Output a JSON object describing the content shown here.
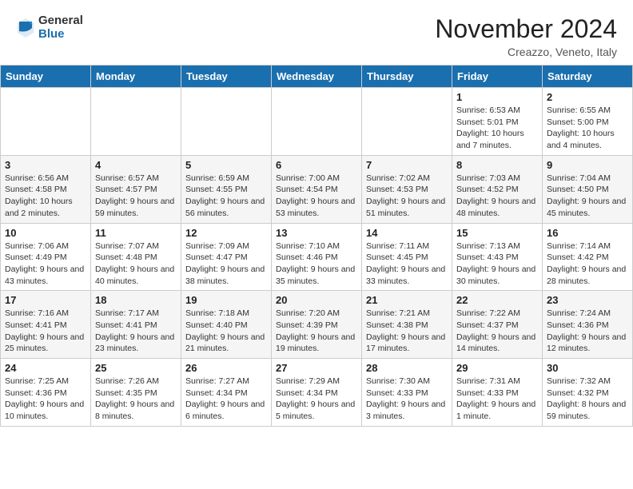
{
  "header": {
    "logo_general": "General",
    "logo_blue": "Blue",
    "month": "November 2024",
    "location": "Creazzo, Veneto, Italy"
  },
  "days_of_week": [
    "Sunday",
    "Monday",
    "Tuesday",
    "Wednesday",
    "Thursday",
    "Friday",
    "Saturday"
  ],
  "weeks": [
    [
      {
        "day": "",
        "info": ""
      },
      {
        "day": "",
        "info": ""
      },
      {
        "day": "",
        "info": ""
      },
      {
        "day": "",
        "info": ""
      },
      {
        "day": "",
        "info": ""
      },
      {
        "day": "1",
        "info": "Sunrise: 6:53 AM\nSunset: 5:01 PM\nDaylight: 10 hours and 7 minutes."
      },
      {
        "day": "2",
        "info": "Sunrise: 6:55 AM\nSunset: 5:00 PM\nDaylight: 10 hours and 4 minutes."
      }
    ],
    [
      {
        "day": "3",
        "info": "Sunrise: 6:56 AM\nSunset: 4:58 PM\nDaylight: 10 hours and 2 minutes."
      },
      {
        "day": "4",
        "info": "Sunrise: 6:57 AM\nSunset: 4:57 PM\nDaylight: 9 hours and 59 minutes."
      },
      {
        "day": "5",
        "info": "Sunrise: 6:59 AM\nSunset: 4:55 PM\nDaylight: 9 hours and 56 minutes."
      },
      {
        "day": "6",
        "info": "Sunrise: 7:00 AM\nSunset: 4:54 PM\nDaylight: 9 hours and 53 minutes."
      },
      {
        "day": "7",
        "info": "Sunrise: 7:02 AM\nSunset: 4:53 PM\nDaylight: 9 hours and 51 minutes."
      },
      {
        "day": "8",
        "info": "Sunrise: 7:03 AM\nSunset: 4:52 PM\nDaylight: 9 hours and 48 minutes."
      },
      {
        "day": "9",
        "info": "Sunrise: 7:04 AM\nSunset: 4:50 PM\nDaylight: 9 hours and 45 minutes."
      }
    ],
    [
      {
        "day": "10",
        "info": "Sunrise: 7:06 AM\nSunset: 4:49 PM\nDaylight: 9 hours and 43 minutes."
      },
      {
        "day": "11",
        "info": "Sunrise: 7:07 AM\nSunset: 4:48 PM\nDaylight: 9 hours and 40 minutes."
      },
      {
        "day": "12",
        "info": "Sunrise: 7:09 AM\nSunset: 4:47 PM\nDaylight: 9 hours and 38 minutes."
      },
      {
        "day": "13",
        "info": "Sunrise: 7:10 AM\nSunset: 4:46 PM\nDaylight: 9 hours and 35 minutes."
      },
      {
        "day": "14",
        "info": "Sunrise: 7:11 AM\nSunset: 4:45 PM\nDaylight: 9 hours and 33 minutes."
      },
      {
        "day": "15",
        "info": "Sunrise: 7:13 AM\nSunset: 4:43 PM\nDaylight: 9 hours and 30 minutes."
      },
      {
        "day": "16",
        "info": "Sunrise: 7:14 AM\nSunset: 4:42 PM\nDaylight: 9 hours and 28 minutes."
      }
    ],
    [
      {
        "day": "17",
        "info": "Sunrise: 7:16 AM\nSunset: 4:41 PM\nDaylight: 9 hours and 25 minutes."
      },
      {
        "day": "18",
        "info": "Sunrise: 7:17 AM\nSunset: 4:41 PM\nDaylight: 9 hours and 23 minutes."
      },
      {
        "day": "19",
        "info": "Sunrise: 7:18 AM\nSunset: 4:40 PM\nDaylight: 9 hours and 21 minutes."
      },
      {
        "day": "20",
        "info": "Sunrise: 7:20 AM\nSunset: 4:39 PM\nDaylight: 9 hours and 19 minutes."
      },
      {
        "day": "21",
        "info": "Sunrise: 7:21 AM\nSunset: 4:38 PM\nDaylight: 9 hours and 17 minutes."
      },
      {
        "day": "22",
        "info": "Sunrise: 7:22 AM\nSunset: 4:37 PM\nDaylight: 9 hours and 14 minutes."
      },
      {
        "day": "23",
        "info": "Sunrise: 7:24 AM\nSunset: 4:36 PM\nDaylight: 9 hours and 12 minutes."
      }
    ],
    [
      {
        "day": "24",
        "info": "Sunrise: 7:25 AM\nSunset: 4:36 PM\nDaylight: 9 hours and 10 minutes."
      },
      {
        "day": "25",
        "info": "Sunrise: 7:26 AM\nSunset: 4:35 PM\nDaylight: 9 hours and 8 minutes."
      },
      {
        "day": "26",
        "info": "Sunrise: 7:27 AM\nSunset: 4:34 PM\nDaylight: 9 hours and 6 minutes."
      },
      {
        "day": "27",
        "info": "Sunrise: 7:29 AM\nSunset: 4:34 PM\nDaylight: 9 hours and 5 minutes."
      },
      {
        "day": "28",
        "info": "Sunrise: 7:30 AM\nSunset: 4:33 PM\nDaylight: 9 hours and 3 minutes."
      },
      {
        "day": "29",
        "info": "Sunrise: 7:31 AM\nSunset: 4:33 PM\nDaylight: 9 hours and 1 minute."
      },
      {
        "day": "30",
        "info": "Sunrise: 7:32 AM\nSunset: 4:32 PM\nDaylight: 8 hours and 59 minutes."
      }
    ]
  ]
}
